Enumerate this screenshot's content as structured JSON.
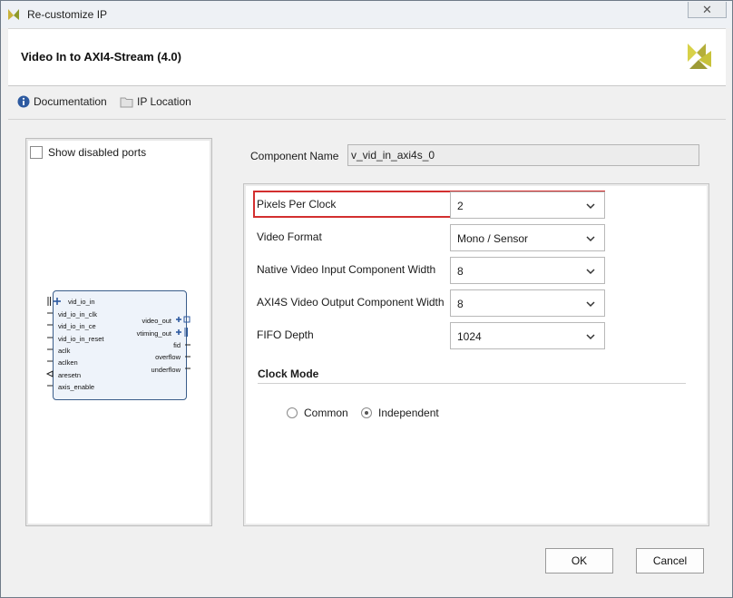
{
  "window": {
    "title": "Re-customize IP",
    "close_glyph": "✕"
  },
  "header": {
    "title": "Video In to AXI4-Stream (4.0)",
    "logo_icon": "xilinx-logo"
  },
  "toolbar": {
    "documentation_label": "Documentation",
    "ip_location_label": "IP Location"
  },
  "left_panel": {
    "show_disabled_ports_label": "Show disabled ports",
    "show_disabled_ports_checked": false,
    "block": {
      "left_ports": [
        "vid_io_in",
        "vid_io_in_clk",
        "vid_io_in_ce",
        "vid_io_in_reset",
        "aclk",
        "aclken",
        "aresetn",
        "axis_enable"
      ],
      "right_ports": [
        "video_out",
        "vtiming_out",
        "fid",
        "overflow",
        "underflow"
      ]
    }
  },
  "component": {
    "label": "Component Name",
    "value": "v_vid_in_axi4s_0"
  },
  "params": [
    {
      "label": "Pixels Per Clock",
      "value": "2",
      "highlighted": true
    },
    {
      "label": "Video Format",
      "value": "Mono / Sensor"
    },
    {
      "label": "Native Video Input Component Width",
      "value": "8"
    },
    {
      "label": "AXI4S Video Output Component Width",
      "value": "8"
    },
    {
      "label": "FIFO Depth",
      "value": "1024"
    }
  ],
  "clock_mode": {
    "title": "Clock Mode",
    "options": [
      {
        "label": "Common",
        "selected": false
      },
      {
        "label": "Independent",
        "selected": true
      }
    ]
  },
  "buttons": {
    "ok": "OK",
    "cancel": "Cancel"
  },
  "colors": {
    "highlight": "#d32f2f",
    "block_border": "#3a5d8a",
    "logo": "#c8c23a"
  }
}
